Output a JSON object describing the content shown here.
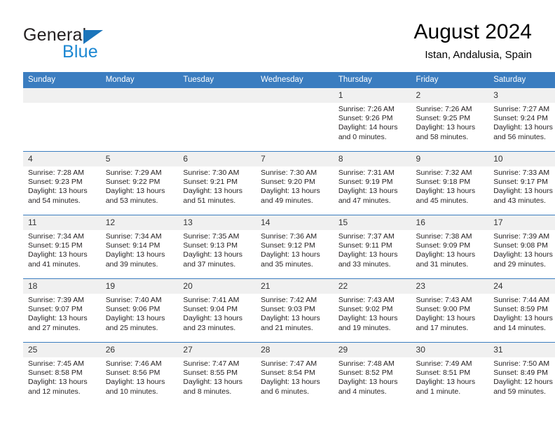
{
  "brand": {
    "name_top": "General",
    "name_bottom": "Blue",
    "triangle_color": "#1b75bb",
    "blue_text_color": "#1b87d2"
  },
  "header": {
    "title": "August 2024",
    "subtitle": "Istan, Andalusia, Spain"
  },
  "theme": {
    "header_blue": "#3b7dc0",
    "daynum_background": "#f0f0f0",
    "text_color": "#231f20"
  },
  "weekdays": [
    "Sunday",
    "Monday",
    "Tuesday",
    "Wednesday",
    "Thursday",
    "Friday",
    "Saturday"
  ],
  "labels": {
    "sunrise_prefix": "Sunrise:",
    "sunset_prefix": "Sunset:",
    "daylight_prefix": "Daylight:"
  },
  "weeks": [
    [
      {
        "day": "",
        "sunrise": "",
        "sunset": "",
        "daylight_line1": "",
        "daylight_line2": "",
        "empty": true
      },
      {
        "day": "",
        "sunrise": "",
        "sunset": "",
        "daylight_line1": "",
        "daylight_line2": "",
        "empty": true
      },
      {
        "day": "",
        "sunrise": "",
        "sunset": "",
        "daylight_line1": "",
        "daylight_line2": "",
        "empty": true
      },
      {
        "day": "",
        "sunrise": "",
        "sunset": "",
        "daylight_line1": "",
        "daylight_line2": "",
        "empty": true
      },
      {
        "day": "1",
        "sunrise": "Sunrise: 7:26 AM",
        "sunset": "Sunset: 9:26 PM",
        "daylight_line1": "Daylight: 14 hours",
        "daylight_line2": "and 0 minutes.",
        "empty": false
      },
      {
        "day": "2",
        "sunrise": "Sunrise: 7:26 AM",
        "sunset": "Sunset: 9:25 PM",
        "daylight_line1": "Daylight: 13 hours",
        "daylight_line2": "and 58 minutes.",
        "empty": false
      },
      {
        "day": "3",
        "sunrise": "Sunrise: 7:27 AM",
        "sunset": "Sunset: 9:24 PM",
        "daylight_line1": "Daylight: 13 hours",
        "daylight_line2": "and 56 minutes.",
        "empty": false
      }
    ],
    [
      {
        "day": "4",
        "sunrise": "Sunrise: 7:28 AM",
        "sunset": "Sunset: 9:23 PM",
        "daylight_line1": "Daylight: 13 hours",
        "daylight_line2": "and 54 minutes.",
        "empty": false
      },
      {
        "day": "5",
        "sunrise": "Sunrise: 7:29 AM",
        "sunset": "Sunset: 9:22 PM",
        "daylight_line1": "Daylight: 13 hours",
        "daylight_line2": "and 53 minutes.",
        "empty": false
      },
      {
        "day": "6",
        "sunrise": "Sunrise: 7:30 AM",
        "sunset": "Sunset: 9:21 PM",
        "daylight_line1": "Daylight: 13 hours",
        "daylight_line2": "and 51 minutes.",
        "empty": false
      },
      {
        "day": "7",
        "sunrise": "Sunrise: 7:30 AM",
        "sunset": "Sunset: 9:20 PM",
        "daylight_line1": "Daylight: 13 hours",
        "daylight_line2": "and 49 minutes.",
        "empty": false
      },
      {
        "day": "8",
        "sunrise": "Sunrise: 7:31 AM",
        "sunset": "Sunset: 9:19 PM",
        "daylight_line1": "Daylight: 13 hours",
        "daylight_line2": "and 47 minutes.",
        "empty": false
      },
      {
        "day": "9",
        "sunrise": "Sunrise: 7:32 AM",
        "sunset": "Sunset: 9:18 PM",
        "daylight_line1": "Daylight: 13 hours",
        "daylight_line2": "and 45 minutes.",
        "empty": false
      },
      {
        "day": "10",
        "sunrise": "Sunrise: 7:33 AM",
        "sunset": "Sunset: 9:17 PM",
        "daylight_line1": "Daylight: 13 hours",
        "daylight_line2": "and 43 minutes.",
        "empty": false
      }
    ],
    [
      {
        "day": "11",
        "sunrise": "Sunrise: 7:34 AM",
        "sunset": "Sunset: 9:15 PM",
        "daylight_line1": "Daylight: 13 hours",
        "daylight_line2": "and 41 minutes.",
        "empty": false
      },
      {
        "day": "12",
        "sunrise": "Sunrise: 7:34 AM",
        "sunset": "Sunset: 9:14 PM",
        "daylight_line1": "Daylight: 13 hours",
        "daylight_line2": "and 39 minutes.",
        "empty": false
      },
      {
        "day": "13",
        "sunrise": "Sunrise: 7:35 AM",
        "sunset": "Sunset: 9:13 PM",
        "daylight_line1": "Daylight: 13 hours",
        "daylight_line2": "and 37 minutes.",
        "empty": false
      },
      {
        "day": "14",
        "sunrise": "Sunrise: 7:36 AM",
        "sunset": "Sunset: 9:12 PM",
        "daylight_line1": "Daylight: 13 hours",
        "daylight_line2": "and 35 minutes.",
        "empty": false
      },
      {
        "day": "15",
        "sunrise": "Sunrise: 7:37 AM",
        "sunset": "Sunset: 9:11 PM",
        "daylight_line1": "Daylight: 13 hours",
        "daylight_line2": "and 33 minutes.",
        "empty": false
      },
      {
        "day": "16",
        "sunrise": "Sunrise: 7:38 AM",
        "sunset": "Sunset: 9:09 PM",
        "daylight_line1": "Daylight: 13 hours",
        "daylight_line2": "and 31 minutes.",
        "empty": false
      },
      {
        "day": "17",
        "sunrise": "Sunrise: 7:39 AM",
        "sunset": "Sunset: 9:08 PM",
        "daylight_line1": "Daylight: 13 hours",
        "daylight_line2": "and 29 minutes.",
        "empty": false
      }
    ],
    [
      {
        "day": "18",
        "sunrise": "Sunrise: 7:39 AM",
        "sunset": "Sunset: 9:07 PM",
        "daylight_line1": "Daylight: 13 hours",
        "daylight_line2": "and 27 minutes.",
        "empty": false
      },
      {
        "day": "19",
        "sunrise": "Sunrise: 7:40 AM",
        "sunset": "Sunset: 9:06 PM",
        "daylight_line1": "Daylight: 13 hours",
        "daylight_line2": "and 25 minutes.",
        "empty": false
      },
      {
        "day": "20",
        "sunrise": "Sunrise: 7:41 AM",
        "sunset": "Sunset: 9:04 PM",
        "daylight_line1": "Daylight: 13 hours",
        "daylight_line2": "and 23 minutes.",
        "empty": false
      },
      {
        "day": "21",
        "sunrise": "Sunrise: 7:42 AM",
        "sunset": "Sunset: 9:03 PM",
        "daylight_line1": "Daylight: 13 hours",
        "daylight_line2": "and 21 minutes.",
        "empty": false
      },
      {
        "day": "22",
        "sunrise": "Sunrise: 7:43 AM",
        "sunset": "Sunset: 9:02 PM",
        "daylight_line1": "Daylight: 13 hours",
        "daylight_line2": "and 19 minutes.",
        "empty": false
      },
      {
        "day": "23",
        "sunrise": "Sunrise: 7:43 AM",
        "sunset": "Sunset: 9:00 PM",
        "daylight_line1": "Daylight: 13 hours",
        "daylight_line2": "and 17 minutes.",
        "empty": false
      },
      {
        "day": "24",
        "sunrise": "Sunrise: 7:44 AM",
        "sunset": "Sunset: 8:59 PM",
        "daylight_line1": "Daylight: 13 hours",
        "daylight_line2": "and 14 minutes.",
        "empty": false
      }
    ],
    [
      {
        "day": "25",
        "sunrise": "Sunrise: 7:45 AM",
        "sunset": "Sunset: 8:58 PM",
        "daylight_line1": "Daylight: 13 hours",
        "daylight_line2": "and 12 minutes.",
        "empty": false
      },
      {
        "day": "26",
        "sunrise": "Sunrise: 7:46 AM",
        "sunset": "Sunset: 8:56 PM",
        "daylight_line1": "Daylight: 13 hours",
        "daylight_line2": "and 10 minutes.",
        "empty": false
      },
      {
        "day": "27",
        "sunrise": "Sunrise: 7:47 AM",
        "sunset": "Sunset: 8:55 PM",
        "daylight_line1": "Daylight: 13 hours",
        "daylight_line2": "and 8 minutes.",
        "empty": false
      },
      {
        "day": "28",
        "sunrise": "Sunrise: 7:47 AM",
        "sunset": "Sunset: 8:54 PM",
        "daylight_line1": "Daylight: 13 hours",
        "daylight_line2": "and 6 minutes.",
        "empty": false
      },
      {
        "day": "29",
        "sunrise": "Sunrise: 7:48 AM",
        "sunset": "Sunset: 8:52 PM",
        "daylight_line1": "Daylight: 13 hours",
        "daylight_line2": "and 4 minutes.",
        "empty": false
      },
      {
        "day": "30",
        "sunrise": "Sunrise: 7:49 AM",
        "sunset": "Sunset: 8:51 PM",
        "daylight_line1": "Daylight: 13 hours",
        "daylight_line2": "and 1 minute.",
        "empty": false
      },
      {
        "day": "31",
        "sunrise": "Sunrise: 7:50 AM",
        "sunset": "Sunset: 8:49 PM",
        "daylight_line1": "Daylight: 12 hours",
        "daylight_line2": "and 59 minutes.",
        "empty": false
      }
    ]
  ]
}
